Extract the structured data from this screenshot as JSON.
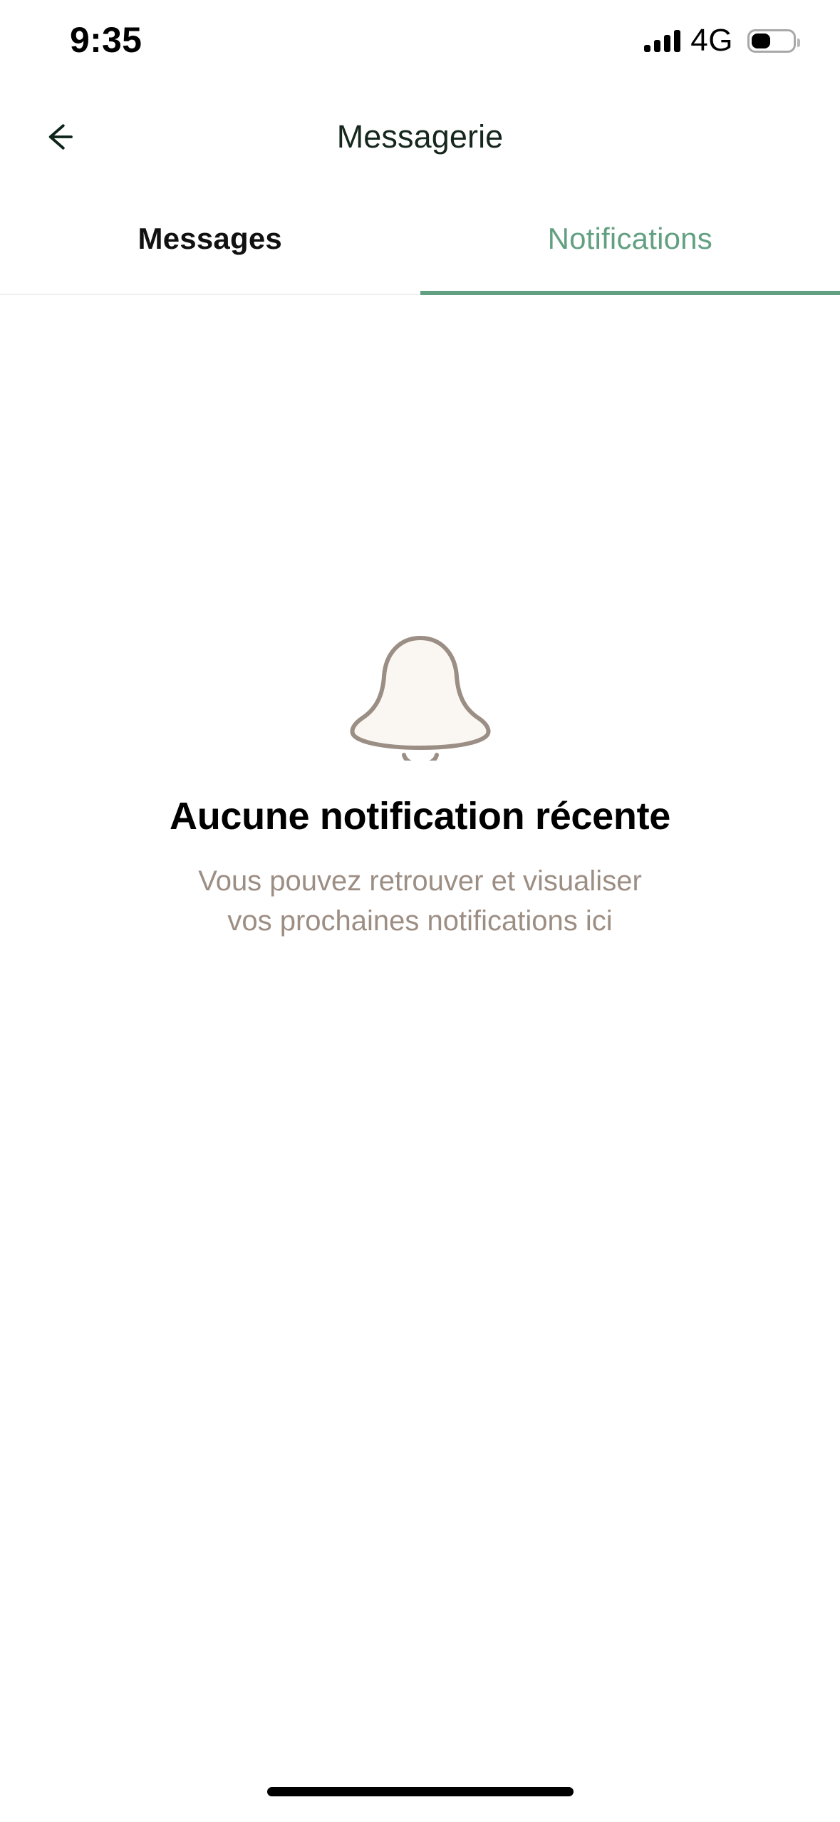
{
  "status_bar": {
    "time": "9:35",
    "network_label": "4G",
    "signal_icon": "signal-bars-icon",
    "signal_bars_filled": 4,
    "battery_icon": "battery-icon",
    "battery_percent": 42
  },
  "nav": {
    "back_icon": "arrow-left-icon",
    "title": "Messagerie"
  },
  "tabs": {
    "active_index": 1,
    "items": [
      {
        "label": "Messages",
        "active": false
      },
      {
        "label": "Notifications",
        "active": true
      }
    ]
  },
  "empty_state": {
    "illustration_icon": "bell-icon",
    "title": "Aucune notification récente",
    "subtitle": "Vous pouvez retrouver et visualiser vos prochaines notifications ici"
  },
  "home_indicator": {
    "name": "home-indicator"
  },
  "colors": {
    "accent_green": "#63a081",
    "title_dark": "#16281e",
    "subtitle_taupe": "#9d8e84",
    "bell_stroke": "#9b8e85",
    "bell_fill": "#faf6f1",
    "background": "#ffffff"
  }
}
